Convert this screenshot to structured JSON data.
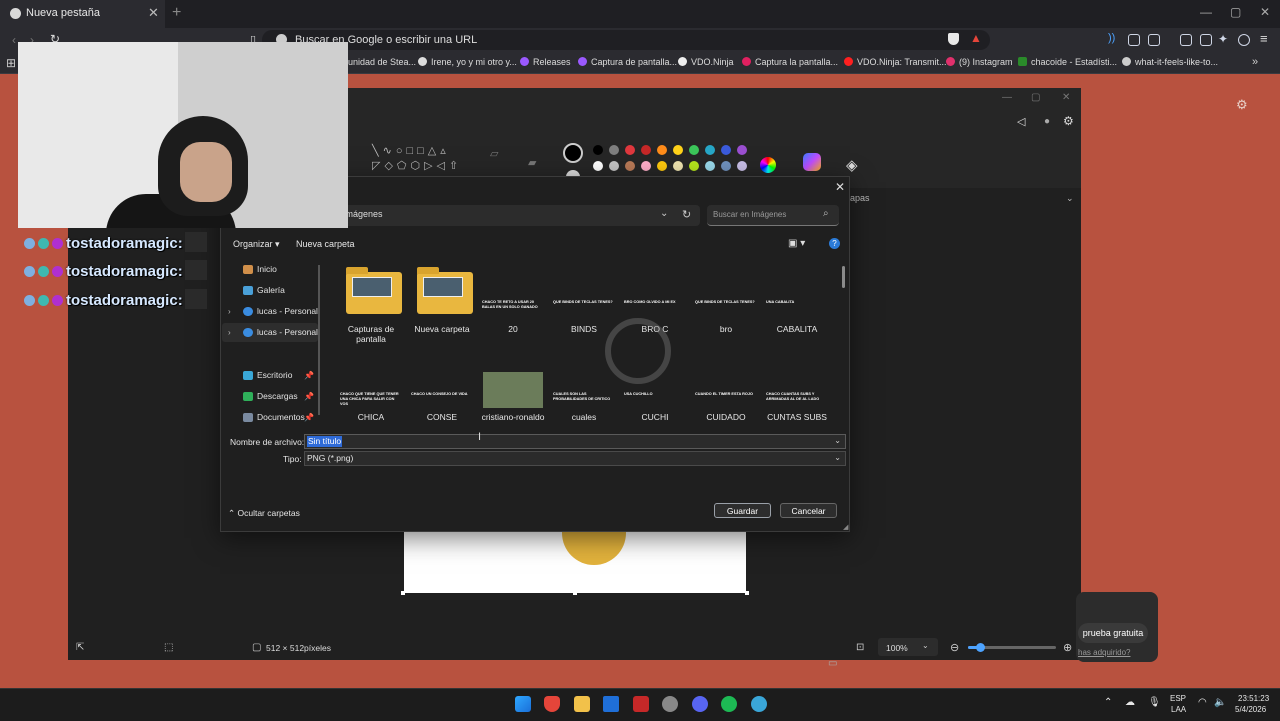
{
  "browser": {
    "tab_title": "Nueva pestaña",
    "url_placeholder": "Buscar en Google o escribir una URL",
    "bookmarks": [
      "unidad de Stea...",
      "Irene, yo y mi otro y...",
      "Releases",
      "Captura de pantalla...",
      "VDO.Ninja",
      "Captura la pantalla...",
      "VDO.Ninja: Transmit...",
      "(9) Instagram",
      "chacoide - Estadísti...",
      "what-it-feels-like-to..."
    ]
  },
  "paint": {
    "layers_label": "apas",
    "status_size": "512 × 512píxeles",
    "zoom": "100%",
    "promo_button": "prueba gratuita",
    "promo_link": "has adquirido?",
    "palette_colors": [
      "#000000",
      "#7f7f7f",
      "#e0383e",
      "#c62828",
      "#ff8c1a",
      "#ffd21a",
      "#3cc65a",
      "#27a7c7",
      "#3b5bdb",
      "#9b4fd1",
      "#ffffff",
      "#c3c3c3",
      "#b97a57",
      "#ffaec9",
      "#ffc90e",
      "#efe4b0",
      "#b5e61d",
      "#99d9ea",
      "#7092be",
      "#c8bfe7"
    ]
  },
  "dialog": {
    "address": "Imágenes",
    "search_placeholder": "Buscar en Imágenes",
    "organize": "Organizar",
    "new_folder": "Nueva carpeta",
    "nav": [
      {
        "label": "Inicio",
        "pinned": false,
        "expand": false
      },
      {
        "label": "Galería",
        "pinned": false,
        "expand": false
      },
      {
        "label": "lucas - Personal",
        "pinned": false,
        "expand": true
      },
      {
        "label": "lucas - Personal",
        "pinned": false,
        "expand": true,
        "selected": true
      },
      {
        "label": "Escritorio",
        "pinned": true,
        "expand": false
      },
      {
        "label": "Descargas",
        "pinned": true,
        "expand": false
      },
      {
        "label": "Documentos",
        "pinned": true,
        "expand": false
      }
    ],
    "files_row1": [
      {
        "name": "Capturas de pantalla",
        "kind": "folder"
      },
      {
        "name": "Nueva carpeta",
        "kind": "folder"
      },
      {
        "name": "20",
        "kind": "image",
        "preview": "CHACO TE RETO A USAR 20 BALAS EN UN SOLO GANADO"
      },
      {
        "name": "BINDS",
        "kind": "image",
        "preview": "QUE BINDS DE TECLAS TENES?"
      },
      {
        "name": "BRO C",
        "kind": "image",
        "preview": "BRO COMO OLVIDO A MI EX"
      },
      {
        "name": "bro",
        "kind": "image",
        "preview": "QUE BINDS DE TECLAS TENES?"
      },
      {
        "name": "CABALITA",
        "kind": "image",
        "preview": "UNA CABALITA"
      }
    ],
    "files_row2": [
      {
        "name": "CHICA",
        "kind": "image",
        "preview": "CHACO QUE TIENE QUE TENER UNA CHICA PARA SALIR CON VOS"
      },
      {
        "name": "CONSE",
        "kind": "image",
        "preview": "CHACO UN CONSEJO DE VIDA"
      },
      {
        "name": "cristiano-ronaldo",
        "kind": "photo",
        "preview": ""
      },
      {
        "name": "cuales",
        "kind": "image",
        "preview": "CUALES SON LAS PROBABILIDADES DE CRITICO"
      },
      {
        "name": "CUCHI",
        "kind": "image",
        "preview": "USA CUCHILLO"
      },
      {
        "name": "CUIDADO",
        "kind": "image",
        "preview": "CUANDO EL TIMER ESTA ROJO"
      },
      {
        "name": "CUNTAS SUBS",
        "kind": "image",
        "preview": "CHACO CUANTAS SUBS Y ARRIMADAS AL DE AL LADO"
      }
    ],
    "filename_label": "Nombre de archivo:",
    "filename_value": "Sin título",
    "type_label": "Tipo:",
    "type_value": "PNG (*.png)",
    "hide_folders": "Ocultar carpetas",
    "save": "Guardar",
    "cancel": "Cancelar"
  },
  "stream": {
    "chat": [
      "tostadoramagic:",
      "tostadoramagic:",
      "tostadoramagic:"
    ]
  },
  "taskbar": {
    "lang1": "ESP",
    "lang2": "LAA",
    "time": "23:51:23",
    "date": "5/4/2026"
  }
}
